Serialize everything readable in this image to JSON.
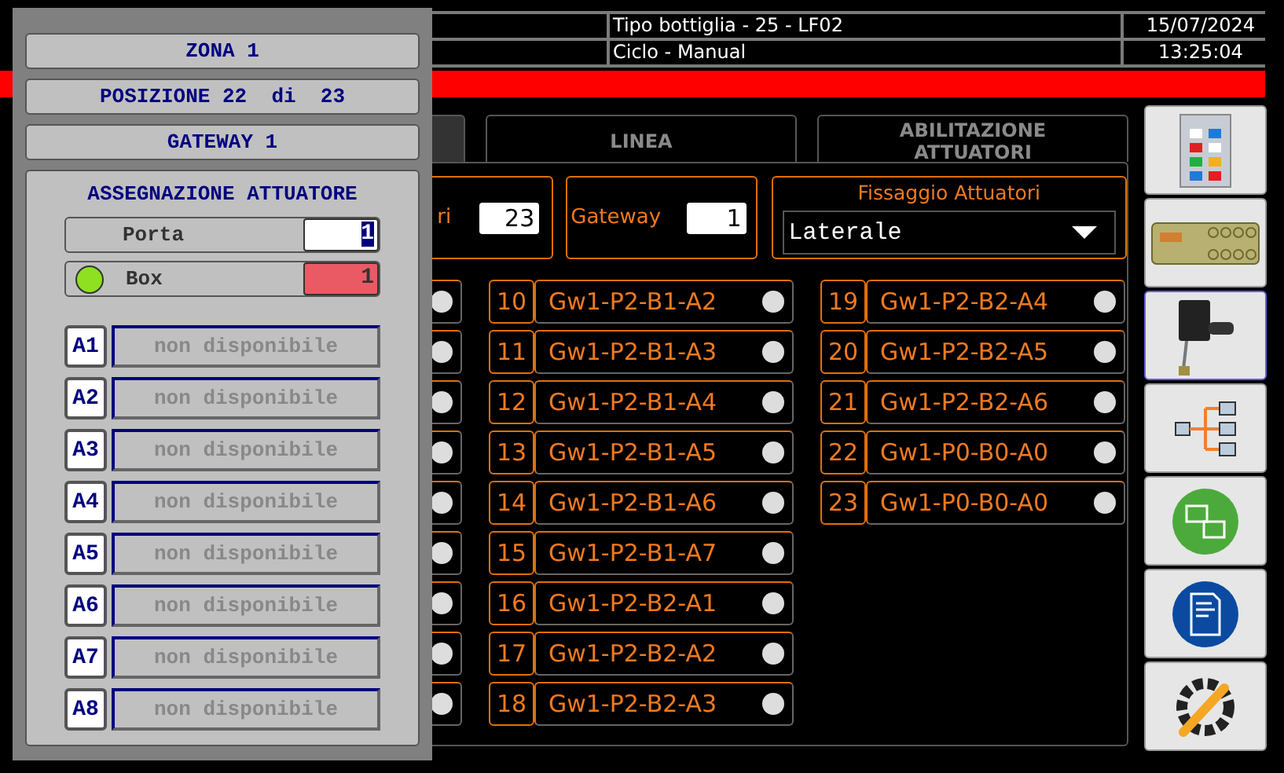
{
  "header": {
    "rows": [
      {
        "info": "Tipo bottiglia - 25 - LF02",
        "value": "15/07/2024"
      },
      {
        "info": "Ciclo - Manual",
        "value": "13:25:04"
      }
    ]
  },
  "alarm_bar": {
    "active": true
  },
  "tabs": [
    {
      "selected": true
    },
    {
      "label": "LINEA",
      "selected": false
    },
    {
      "label": "ABILITAZIONE ATTUATORI",
      "selected": false
    }
  ],
  "fields": {
    "count_label": "ri",
    "count_value": "23",
    "gateway_label": "Gateway",
    "gateway_value": "1",
    "mount_title": "Fissaggio Attuatori",
    "mount_value": "Laterale"
  },
  "columns": [
    [
      {
        "on": false
      },
      {
        "on": false
      },
      {
        "on": false
      },
      {
        "on": false
      },
      {
        "on": false
      },
      {
        "on": false
      },
      {
        "on": false
      },
      {
        "on": false
      },
      {
        "on": false
      }
    ],
    [
      {
        "number": "10",
        "label": "Gw1-P2-B1-A2",
        "on": false
      },
      {
        "number": "11",
        "label": "Gw1-P2-B1-A3",
        "on": false
      },
      {
        "number": "12",
        "label": "Gw1-P2-B1-A4",
        "on": false
      },
      {
        "number": "13",
        "label": "Gw1-P2-B1-A5",
        "on": false
      },
      {
        "number": "14",
        "label": "Gw1-P2-B1-A6",
        "on": false
      },
      {
        "number": "15",
        "label": "Gw1-P2-B1-A7",
        "on": false
      },
      {
        "number": "16",
        "label": "Gw1-P2-B2-A1",
        "on": false
      },
      {
        "number": "17",
        "label": "Gw1-P2-B2-A2",
        "on": false
      },
      {
        "number": "18",
        "label": "Gw1-P2-B2-A3",
        "on": false
      }
    ],
    [
      {
        "number": "19",
        "label": "Gw1-P2-B2-A4",
        "on": false
      },
      {
        "number": "20",
        "label": "Gw1-P2-B2-A5",
        "on": false
      },
      {
        "number": "21",
        "label": "Gw1-P2-B2-A6",
        "on": false
      },
      {
        "number": "22",
        "label": "Gw1-P0-B0-A0",
        "on": false
      },
      {
        "number": "23",
        "label": "Gw1-P0-B0-A0",
        "on": false
      }
    ]
  ],
  "sidebar": [
    {
      "kind": "panel",
      "selected": false
    },
    {
      "kind": "board",
      "selected": false
    },
    {
      "kind": "sensor",
      "selected": true
    },
    {
      "kind": "tree",
      "selected": false
    },
    {
      "kind": "network",
      "selected": false
    },
    {
      "kind": "document",
      "selected": false
    },
    {
      "kind": "tools",
      "selected": false
    }
  ],
  "popup": {
    "titles": [
      "ZONA 1",
      "POSIZIONE 22  di  23",
      "GATEWAY 1"
    ],
    "assignment": {
      "title": "ASSEGNAZIONE ATTUATORE",
      "porta_label": "Porta",
      "porta_value": "1",
      "box_label": "Box",
      "box_value": "1",
      "box_ok": true,
      "actuators": [
        {
          "id": "A1",
          "value": "non disponibile"
        },
        {
          "id": "A2",
          "value": "non disponibile"
        },
        {
          "id": "A3",
          "value": "non disponibile"
        },
        {
          "id": "A4",
          "value": "non disponibile"
        },
        {
          "id": "A5",
          "value": "non disponibile"
        },
        {
          "id": "A6",
          "value": "non disponibile"
        },
        {
          "id": "A7",
          "value": "non disponibile"
        },
        {
          "id": "A8",
          "value": "non disponibile"
        }
      ]
    }
  }
}
